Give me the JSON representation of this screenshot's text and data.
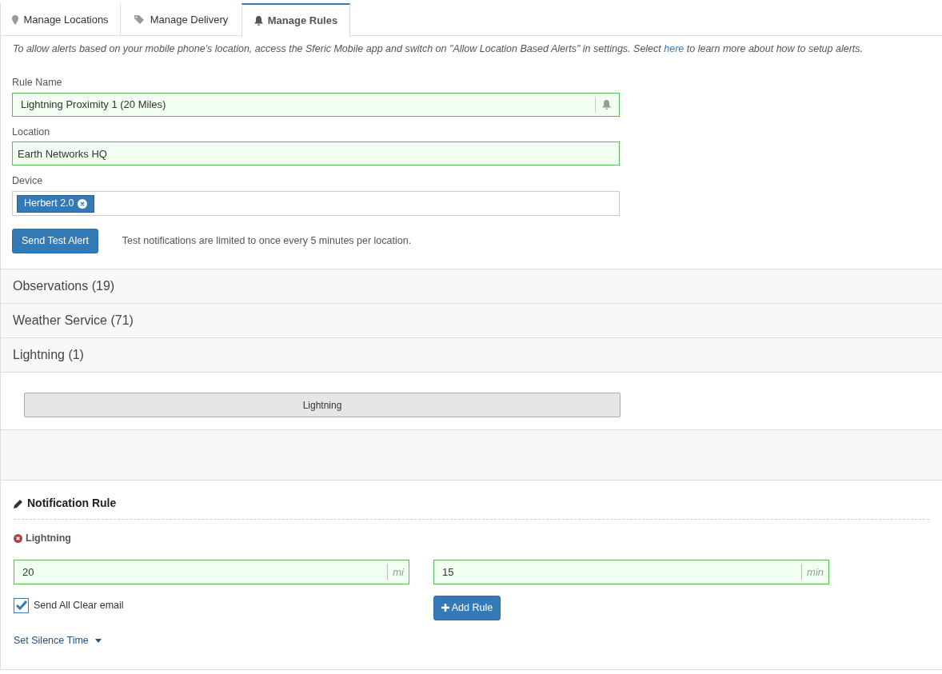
{
  "tabs": [
    {
      "label": "Manage Locations",
      "selected": false
    },
    {
      "label": "Manage Delivery",
      "selected": false
    },
    {
      "label": "Manage Rules",
      "selected": true
    }
  ],
  "info": {
    "before": "To allow alerts based on your mobile phone's location, access the Sferic Mobile app and switch on \"Allow Location Based Alerts\" in settings. Select ",
    "link": "here",
    "after": " to learn more about how to setup alerts."
  },
  "rule_name": {
    "label": "Rule Name",
    "value": "Lightning Proximity 1 (20 Miles)"
  },
  "location": {
    "label": "Location",
    "value": "Earth Networks HQ"
  },
  "device": {
    "label": "Device",
    "tags": [
      "Herbert 2.0"
    ]
  },
  "test_button": "Send Test Alert",
  "test_note": "Test notifications are limited to once every 5 minutes per location.",
  "sections": [
    {
      "title": "Observations (19)"
    },
    {
      "title": "Weather Service (71)"
    },
    {
      "title": "Lightning (1)",
      "items": [
        "Lightning"
      ]
    }
  ],
  "notification": {
    "title": "Notification Rule",
    "rule": "Lightning",
    "distance": {
      "value": "20",
      "unit": "mi"
    },
    "time": {
      "value": "15",
      "unit": "min"
    },
    "all_clear": {
      "label": "Send All Clear email",
      "checked": true
    },
    "add_button": "Add Rule",
    "silence_link": "Set Silence Time"
  }
}
